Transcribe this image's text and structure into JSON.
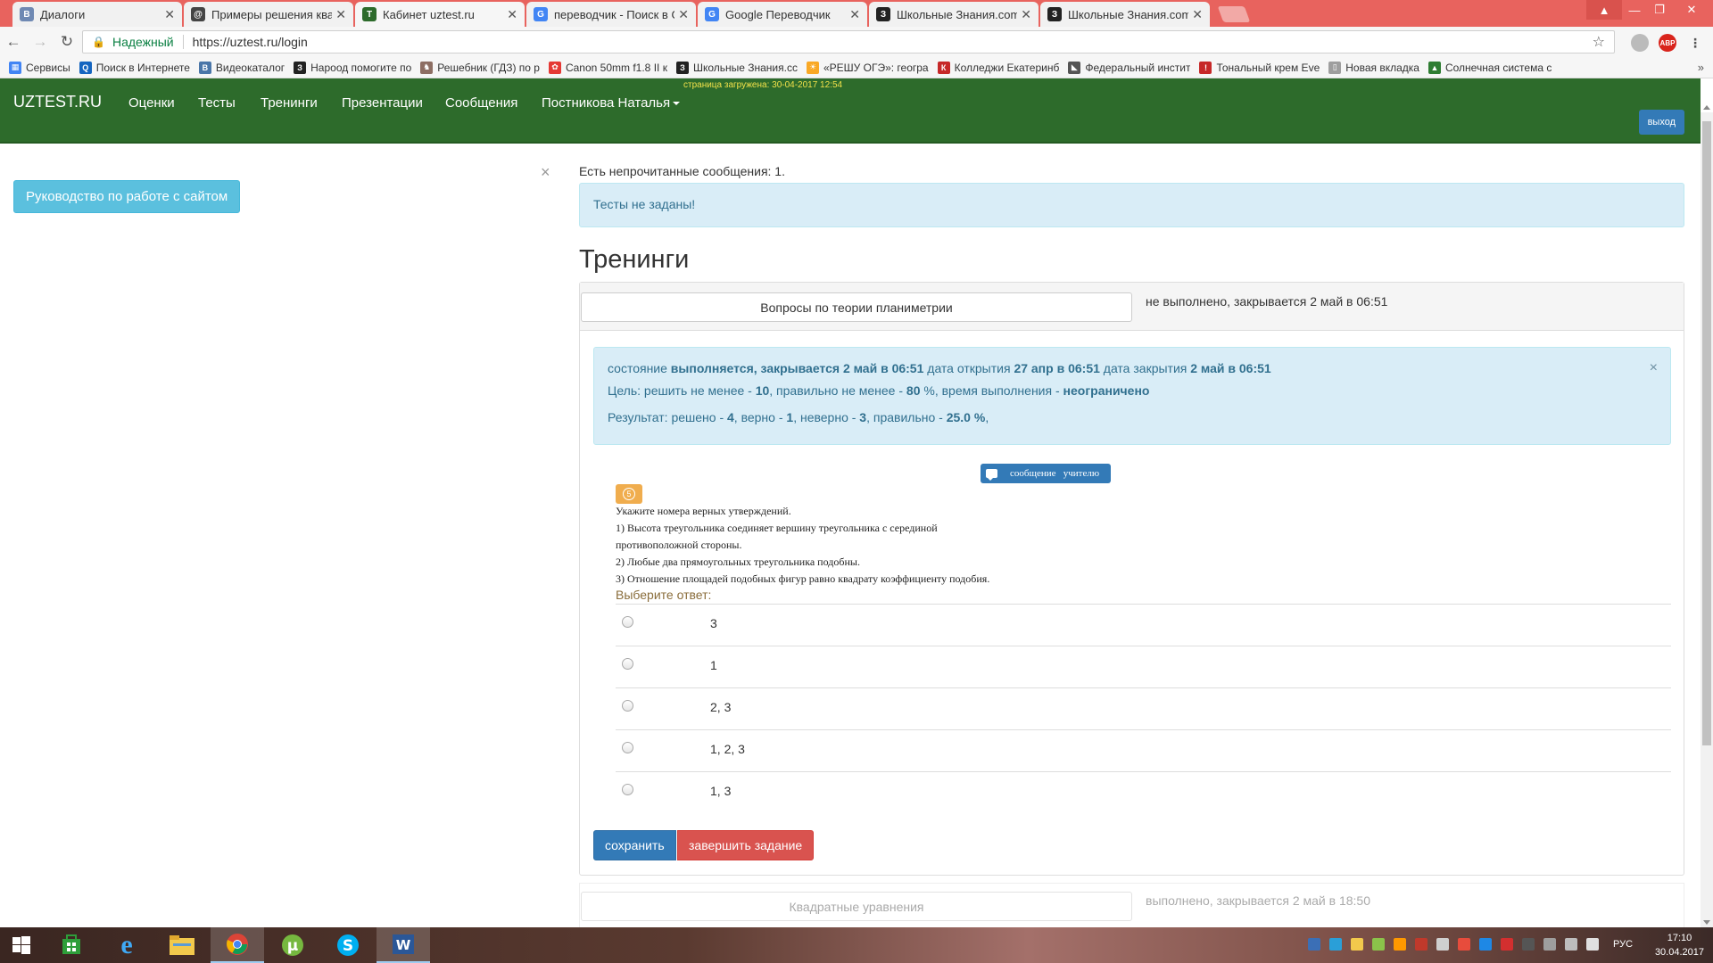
{
  "browser": {
    "tabs": [
      {
        "label": "Диалоги",
        "icon": "vk-icon",
        "color": "#6f89b3",
        "glyph": "В"
      },
      {
        "label": "Примеры решения квад",
        "icon": "logo-icon",
        "color": "#444444",
        "glyph": "@"
      },
      {
        "label": "Кабинет uztest.ru",
        "icon": "uztest-icon",
        "color": "#2d6b2b",
        "glyph": "T"
      },
      {
        "label": "переводчик - Поиск в G",
        "icon": "google-icon",
        "color": "#4285f4",
        "glyph": "G"
      },
      {
        "label": "Google Переводчик",
        "icon": "translate-icon",
        "color": "#4285f4",
        "glyph": "G"
      },
      {
        "label": "Школьные Знания.com",
        "icon": "znanija-icon",
        "color": "#222222",
        "glyph": "З"
      },
      {
        "label": "Школьные Знания.com",
        "icon": "znanija-icon",
        "color": "#222222",
        "glyph": "З"
      }
    ],
    "secure_label": "Надежный",
    "url": "https://uztest.ru/login",
    "extension_label": "ABP",
    "bookmarks": [
      {
        "label": "Сервисы",
        "color": "#4285f4",
        "glyph": "▦"
      },
      {
        "label": "Поиск в Интернете",
        "color": "#1565c0",
        "glyph": "Q"
      },
      {
        "label": "Видеокаталог",
        "color": "#4a76a8",
        "glyph": "В"
      },
      {
        "label": "Нарoод помогите по",
        "color": "#222222",
        "glyph": "З"
      },
      {
        "label": "Решебник (ГДЗ) по р",
        "color": "#8d6e63",
        "glyph": "♞"
      },
      {
        "label": "Canon 50mm f1.8 II к",
        "color": "#e53935",
        "glyph": "✿"
      },
      {
        "label": "Школьные Знания.cc",
        "color": "#222222",
        "glyph": "З"
      },
      {
        "label": "«РЕШУ ОГЭ»: геогра",
        "color": "#f9a825",
        "glyph": "☀"
      },
      {
        "label": "Колледжи Екатеринб",
        "color": "#c62828",
        "glyph": "К"
      },
      {
        "label": "Федеральный инстит",
        "color": "#555555",
        "glyph": "◣"
      },
      {
        "label": "Тональный крем Eve",
        "color": "#c62828",
        "glyph": "!"
      },
      {
        "label": "Новая вкладка",
        "color": "#9e9e9e",
        "glyph": "▯"
      },
      {
        "label": "Солнечная система с",
        "color": "#2e7d32",
        "glyph": "▲"
      }
    ]
  },
  "site": {
    "brand": "UZTEST.RU",
    "nav": [
      "Оценки",
      "Тесты",
      "Тренинги",
      "Презентации",
      "Сообщения"
    ],
    "user": "Постникова Наталья",
    "loaded": "страница загружена: 30-04-2017 12:54",
    "logout": "выход",
    "guide_button": "Руководство по работе с сайтом",
    "dismiss": "×",
    "unread": "Есть непрочитанные сообщения: 1.",
    "alert": "Тесты не заданы!",
    "title": "Тренинги"
  },
  "training": {
    "name": "Вопросы по теории планиметрии",
    "status": "не выполнено, закрывается 2 май в 06:51",
    "state": {
      "l1": [
        "состояние ",
        "выполняется, закрывается 2 май в 06:51",
        " дата открытия ",
        "27 апр в 06:51",
        " дата закрытия ",
        "2 май в 06:51"
      ],
      "l2": [
        "Цель: решить не менее - ",
        "10",
        ", правильно не менее - ",
        "80",
        " %, время выполнения - ",
        "неограничено"
      ],
      "l3": [
        "Результат: решено - ",
        "4",
        ", верно - ",
        "1",
        ", неверно - ",
        "3",
        ", правильно - ",
        "25.0 %",
        ","
      ],
      "close": "×"
    },
    "message_teacher": "сообщение   учителю",
    "question_number": "5",
    "question_lines": [
      "Укажите номера верных утверждений.",
      "1) Высота треугольника соединяет вершину треугольника с серединой",
      "противоположной стороны.",
      "2) Любые два прямоугольных треугольника подобны.",
      "3) Отношение площадей подобных фигур равно квадрату коэффициенту подобия."
    ],
    "choose_label": "Выберите ответ:",
    "answers": [
      "3",
      "1",
      "2, 3",
      "1, 2, 3",
      "1, 3"
    ],
    "save": "сохранить",
    "finish": "завершить задание"
  },
  "next_training": {
    "name": "Квадратные уравнения",
    "status": "выполнено, закрывается 2 май в 18:50"
  },
  "taskbar": {
    "lang": "РУС",
    "time": "17:10",
    "date": "30.04.2017"
  }
}
